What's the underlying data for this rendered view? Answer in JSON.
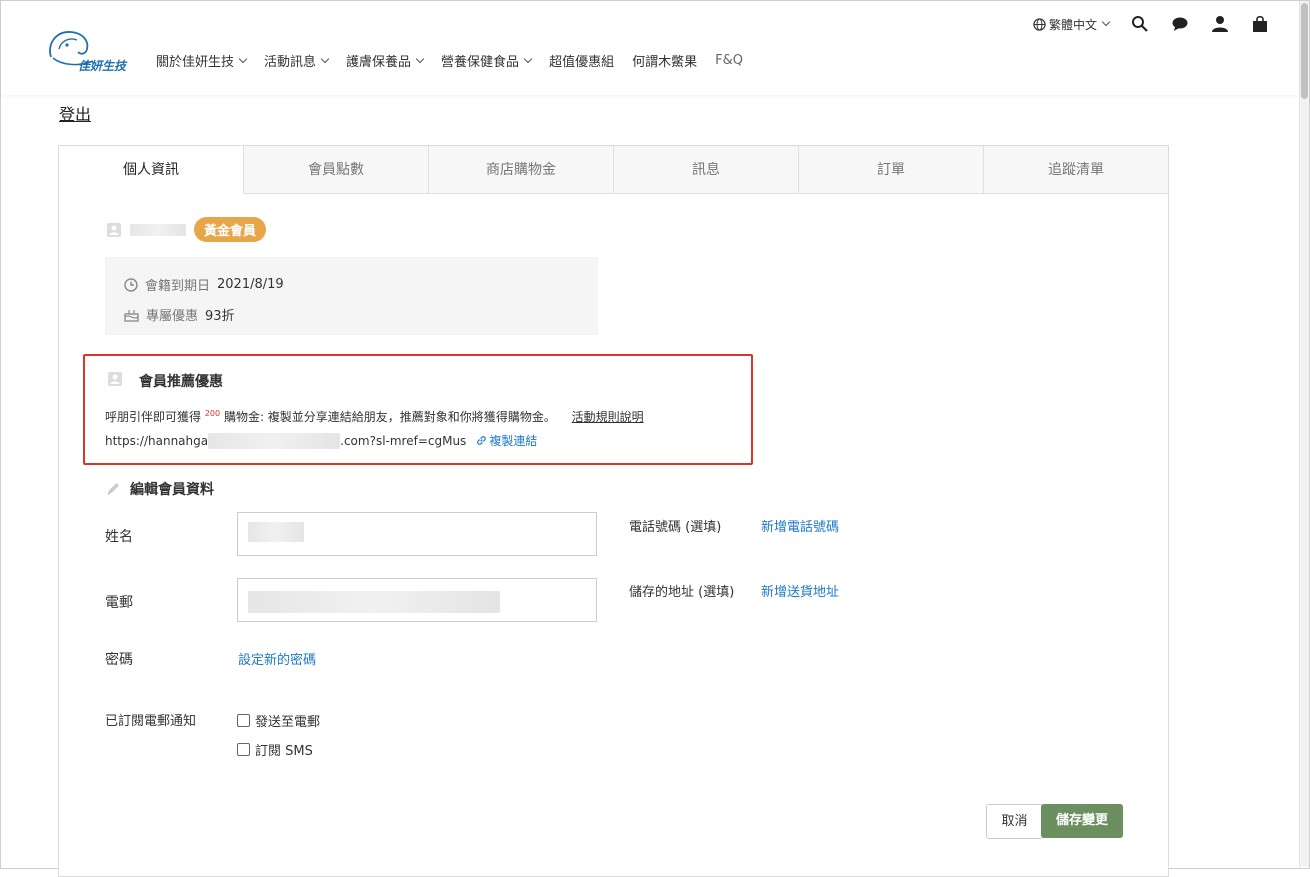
{
  "header": {
    "logo_text": "佳妍生技",
    "language": "繁體中文",
    "nav": [
      {
        "label": "關於佳妍生技",
        "dropdown": true
      },
      {
        "label": "活動訊息",
        "dropdown": true
      },
      {
        "label": "護膚保養品",
        "dropdown": true
      },
      {
        "label": "營養保健食品",
        "dropdown": true
      },
      {
        "label": "超值優惠組",
        "dropdown": false
      },
      {
        "label": "何謂木鱉果",
        "dropdown": false
      },
      {
        "label": "F&Q",
        "dropdown": false
      }
    ]
  },
  "logout_label": "登出",
  "tabs": [
    "個人資訊",
    "會員點數",
    "商店購物金",
    "訊息",
    "訂單",
    "追蹤清單"
  ],
  "member": {
    "tier_badge": "黃金會員",
    "expiry_label": "會籍到期日",
    "expiry_value": "2021/8/19",
    "discount_label": "專屬優惠",
    "discount_value": "93折"
  },
  "referral": {
    "title": "會員推薦優惠",
    "desc_prefix": "呼朋引伴即可獲得",
    "amount": "200",
    "desc_suffix": "購物金: 複製並分享連結給朋友，推薦對象和你將獲得購物金。",
    "rules_link": "活動規則說明",
    "url_prefix": "https://hannahga",
    "url_suffix": ".com?sl-mref=cgMus",
    "copy_link": "複製連結"
  },
  "edit": {
    "title": "編輯會員資料",
    "name_label": "姓名",
    "email_label": "電郵",
    "password_label": "密碼",
    "password_link": "設定新的密碼",
    "phone_label": "電話號碼 (選填)",
    "phone_link": "新增電話號碼",
    "address_label": "儲存的地址 (選填)",
    "address_link": "新增送貨地址",
    "subscribe_label": "已訂閱電郵通知",
    "opt_email": "發送至電郵",
    "opt_sms": "訂閱 SMS"
  },
  "buttons": {
    "cancel": "取消",
    "save": "儲存變更"
  },
  "colors": {
    "gold": "#e8a64a",
    "link": "#1e78c8",
    "highlight_border": "#d9352a",
    "save_button": "#6b8f5e"
  }
}
